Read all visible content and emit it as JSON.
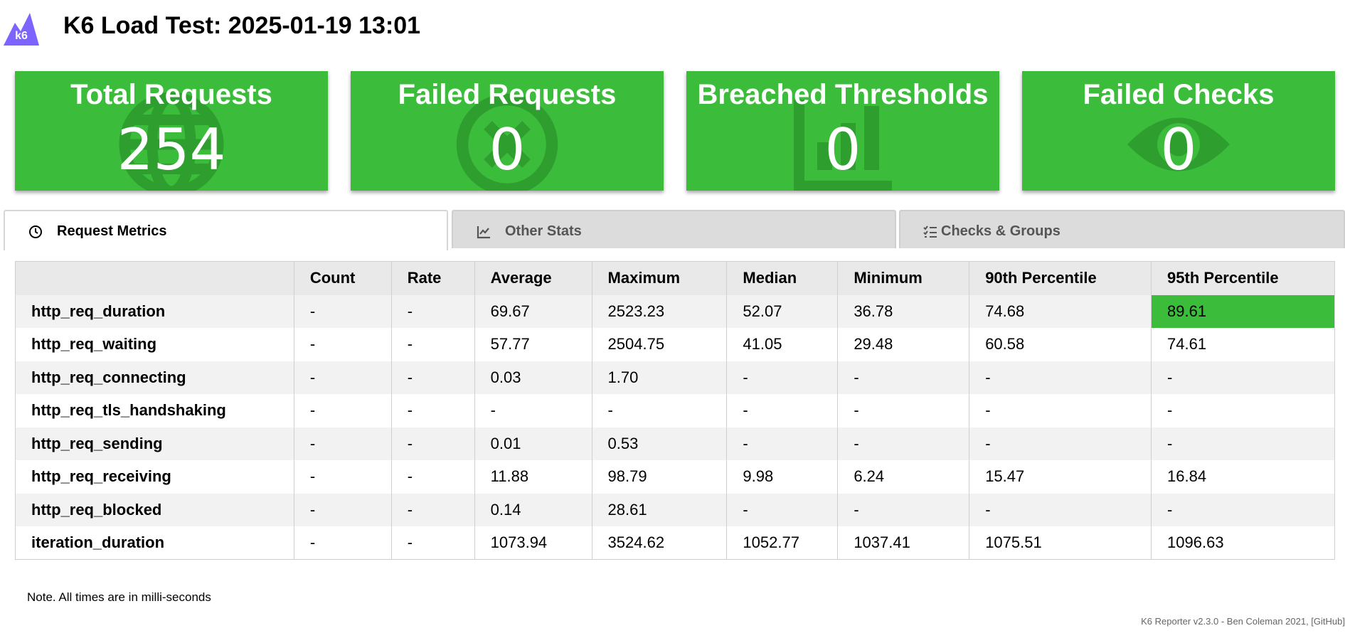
{
  "header": {
    "logo_text": "k6",
    "title": "K6 Load Test: 2025-01-19 13:01"
  },
  "cards": [
    {
      "title": "Total Requests",
      "value": "254",
      "icon": "globe-icon"
    },
    {
      "title": "Failed Requests",
      "value": "0",
      "icon": "x-circle-icon"
    },
    {
      "title": "Breached Thresholds",
      "value": "0",
      "icon": "bar-chart-icon"
    },
    {
      "title": "Failed Checks",
      "value": "0",
      "icon": "eye-icon"
    }
  ],
  "tabs": [
    {
      "label": "Request Metrics",
      "icon": "clock-icon",
      "active": true
    },
    {
      "label": "Other Stats",
      "icon": "line-chart-icon",
      "active": false
    },
    {
      "label": "Checks & Groups",
      "icon": "checklist-icon",
      "active": false
    }
  ],
  "table": {
    "headers": [
      "",
      "Count",
      "Rate",
      "Average",
      "Maximum",
      "Median",
      "Minimum",
      "90th Percentile",
      "95th Percentile"
    ],
    "rows": [
      [
        "http_req_duration",
        "-",
        "-",
        "69.67",
        "2523.23",
        "52.07",
        "36.78",
        "74.68",
        "89.61"
      ],
      [
        "http_req_waiting",
        "-",
        "-",
        "57.77",
        "2504.75",
        "41.05",
        "29.48",
        "60.58",
        "74.61"
      ],
      [
        "http_req_connecting",
        "-",
        "-",
        "0.03",
        "1.70",
        "-",
        "-",
        "-",
        "-"
      ],
      [
        "http_req_tls_handshaking",
        "-",
        "-",
        "-",
        "-",
        "-",
        "-",
        "-",
        "-"
      ],
      [
        "http_req_sending",
        "-",
        "-",
        "0.01",
        "0.53",
        "-",
        "-",
        "-",
        "-"
      ],
      [
        "http_req_receiving",
        "-",
        "-",
        "11.88",
        "98.79",
        "9.98",
        "6.24",
        "15.47",
        "16.84"
      ],
      [
        "http_req_blocked",
        "-",
        "-",
        "0.14",
        "28.61",
        "-",
        "-",
        "-",
        "-"
      ],
      [
        "iteration_duration",
        "-",
        "-",
        "1073.94",
        "3524.62",
        "1052.77",
        "1037.41",
        "1075.51",
        "1096.63"
      ]
    ]
  },
  "note": "Note. All times are in milli-seconds",
  "footer": "K6 Reporter v2.3.0 - Ben Coleman 2021, [GitHub]",
  "colors": {
    "card_green": "#3bbd3b",
    "logo_purple": "#7d64ff",
    "tab_inactive": "#dcdcdc"
  }
}
